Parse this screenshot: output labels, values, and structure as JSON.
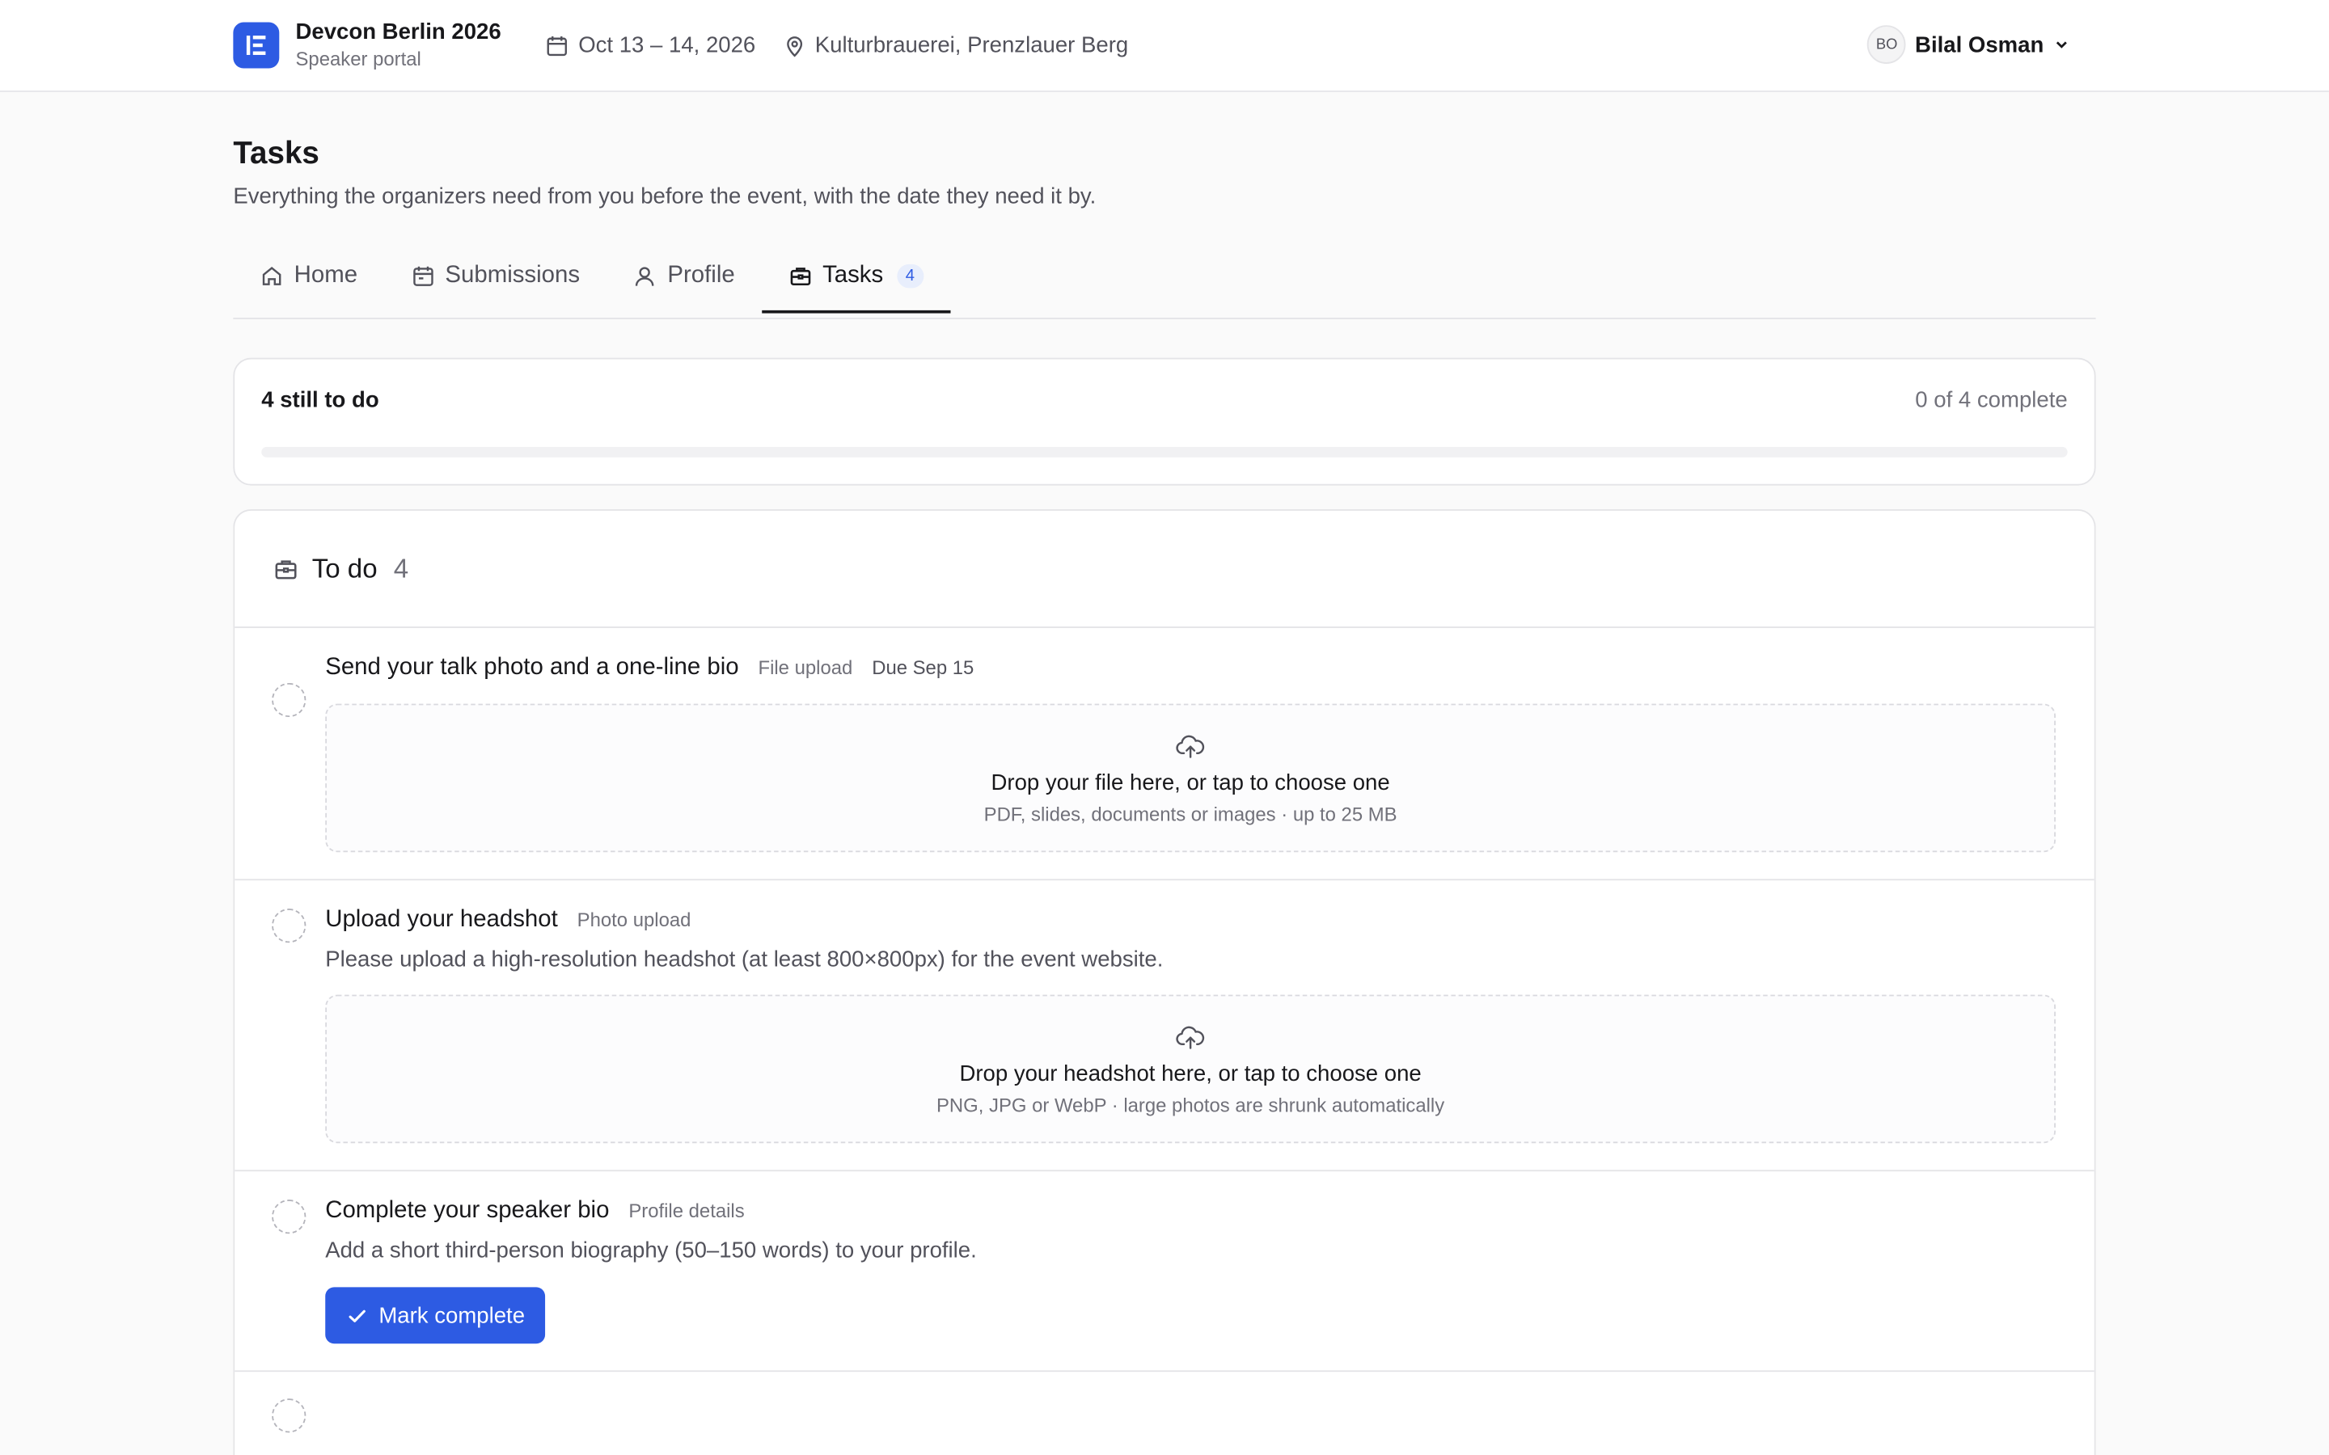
{
  "header": {
    "event_title": "Devcon Berlin 2026",
    "portal_label": "Speaker portal",
    "dates": "Oct 13 – 14, 2026",
    "venue": "Kulturbrauerei, Prenzlauer Berg",
    "user_initials": "BO",
    "user_name": "Bilal Osman"
  },
  "page": {
    "title": "Tasks",
    "description": "Everything the organizers need from you before the event, with the date they need it by."
  },
  "tabs": [
    {
      "label": "Home",
      "icon": "home-icon"
    },
    {
      "label": "Submissions",
      "icon": "calendar-icon"
    },
    {
      "label": "Profile",
      "icon": "user-icon"
    },
    {
      "label": "Tasks",
      "icon": "briefcase-icon",
      "badge": "4",
      "active": true
    }
  ],
  "progress": {
    "remaining_label": "4 still to do",
    "complete_label": "0 of 4 complete",
    "fraction": 0
  },
  "todo": {
    "title": "To do",
    "count": "4",
    "tasks": [
      {
        "title": "Send your talk photo and a one-line bio",
        "type": "File upload",
        "due": "Due Sep 15",
        "dropzone_title": "Drop your file here, or tap to choose one",
        "dropzone_sub": "PDF, slides, documents or images · up to 25 MB"
      },
      {
        "title": "Upload your headshot",
        "type": "Photo upload",
        "description": "Please upload a high-resolution headshot (at least 800×800px) for the event website.",
        "dropzone_title": "Drop your headshot here, or tap to choose one",
        "dropzone_sub": "PNG, JPG or WebP · large photos are shrunk automatically"
      },
      {
        "title": "Complete your speaker bio",
        "type": "Profile details",
        "description": "Add a short third-person biography (50–150 words) to your profile.",
        "button_label": "Mark complete"
      }
    ]
  },
  "colors": {
    "accent": "#2d5be3",
    "text": "#18181b",
    "muted": "#71717a",
    "border": "#e4e4e7",
    "background": "#fafafa"
  }
}
